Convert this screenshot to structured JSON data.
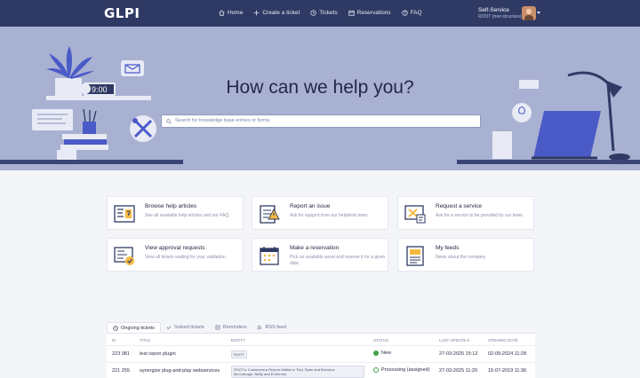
{
  "app": {
    "logo": "GLPI"
  },
  "nav": [
    {
      "label": "Home",
      "icon": "home-icon"
    },
    {
      "label": "Create a ticket",
      "icon": "plus-icon"
    },
    {
      "label": "Tickets",
      "icon": "clock-icon"
    },
    {
      "label": "Reservations",
      "icon": "calendar-icon"
    },
    {
      "label": "FAQ",
      "icon": "help-icon"
    }
  ],
  "profile": {
    "name": "Self-Service",
    "entity": "ROOT (tree structure)"
  },
  "hero": {
    "title": "How can we help you?",
    "search_placeholder": "Search for knowledge base entries or forms",
    "clock_text": "9:00"
  },
  "cards": [
    {
      "title": "Browse help articles",
      "desc": "See all available help articles and our FAQ.",
      "icon": "help-articles-icon"
    },
    {
      "title": "Report an issue",
      "desc": "Ask for support from our helpdesk team.",
      "icon": "report-issue-icon"
    },
    {
      "title": "Request a service",
      "desc": "Ask for a service to be provided by our team.",
      "icon": "request-service-icon"
    },
    {
      "title": "View approval requests",
      "desc": "View all tickets waiting for your validation.",
      "icon": "approval-icon"
    },
    {
      "title": "Make a reservation",
      "desc": "Pick an available asset and reserve it for a given date.",
      "icon": "reservation-icon"
    },
    {
      "title": "My feeds",
      "desc": "News about the company",
      "icon": "feeds-icon"
    }
  ],
  "tabs": [
    {
      "label": "Ongoing tickets",
      "icon": "clock-icon"
    },
    {
      "label": "Solved tickets",
      "icon": "check-icon"
    },
    {
      "label": "Reminders",
      "icon": "note-icon"
    },
    {
      "label": "RSS feed",
      "icon": "rss-icon"
    }
  ],
  "table": {
    "columns": [
      "ID",
      "TITLE",
      "ENTITY",
      "STATUS",
      "LAST UPDATE",
      "OPENING DATE"
    ],
    "rows": [
      {
        "id": "223 081",
        "title": "test repon plugin",
        "entity": "ROOT",
        "entity2": "",
        "status": "New",
        "last_update": "27-03-2025 15:12",
        "opening": "02-09-2024 11:28"
      },
      {
        "id": "221 255",
        "title": "synergize plug-and-play webservices",
        "entity": "ROOT ▸ Customers ▸ Reynor-Walker ▸ Tripl, Ryan and Brooks ▸",
        "entity2": "McCullough, Beilly and Entrenmh",
        "status": "Processing (assigned)",
        "last_update": "27-03-2025 11:20",
        "opening": "15-07-2019 11:36"
      }
    ]
  },
  "colors": {
    "navbar": "#2f3a64",
    "hero": "#a9b1d2",
    "accent": "#4a5ac7",
    "status_green": "#43a047"
  }
}
